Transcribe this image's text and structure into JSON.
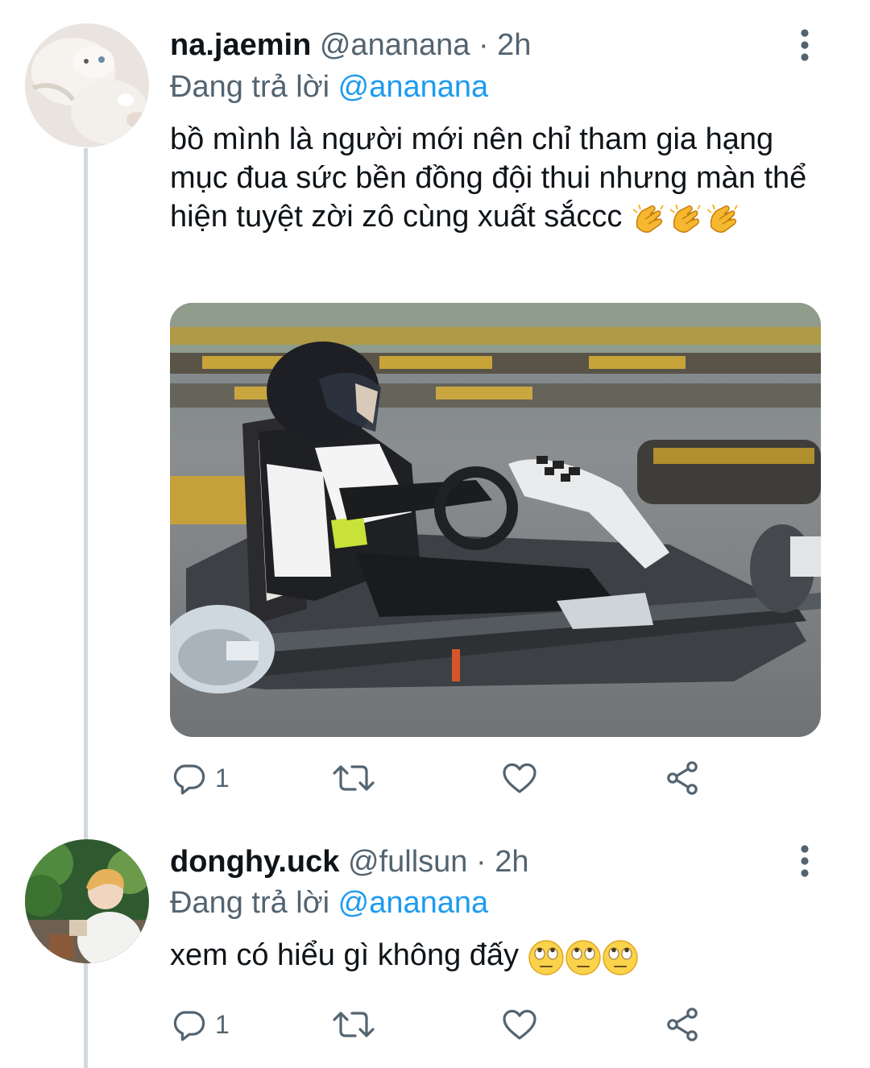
{
  "tweets": [
    {
      "display_name": "na.jaemin",
      "handle": "@ananana",
      "separator": "·",
      "time": "2h",
      "reply_prefix": "Đang trả lời",
      "reply_to": "@ananana",
      "text": "bồ mình là người mới nên chỉ tham gia hạng mục đua sức bền đồng đội thui nhưng màn thể hiện tuyệt zời zô cùng xuất sắccc",
      "emoji": [
        "clapping-hands",
        "clapping-hands",
        "clapping-hands"
      ],
      "reply_count": "1",
      "media": "photo of a person in a helmet driving a go-kart"
    },
    {
      "display_name": "donghy.uck",
      "handle": "@fullsun",
      "separator": "·",
      "time": "2h",
      "reply_prefix": "Đang trả lời",
      "reply_to": "@ananana",
      "text": "xem có hiểu gì không đấy",
      "emoji": [
        "face-with-rolling-eyes",
        "face-with-rolling-eyes",
        "face-with-rolling-eyes"
      ],
      "reply_count": "1"
    }
  ],
  "icons": {
    "reply": "reply-icon",
    "retweet": "retweet-icon",
    "like": "heart-icon",
    "share": "share-icon",
    "more": "more-vertical-icon"
  },
  "colors": {
    "primary_text": "#0f1419",
    "secondary_text": "#536471",
    "mention": "#1d9bf0",
    "thread_line": "#cfd9de"
  }
}
